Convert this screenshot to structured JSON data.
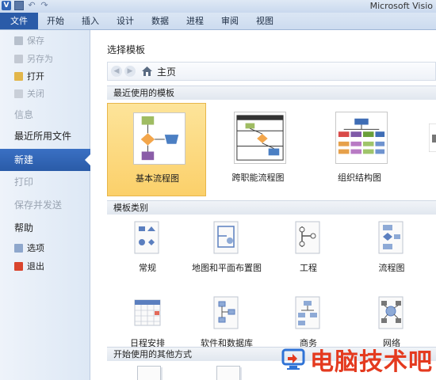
{
  "window": {
    "title": "Microsoft Visio"
  },
  "quick_access": {
    "logo_letter": "V"
  },
  "ribbon": {
    "tabs": [
      "文件",
      "开始",
      "插入",
      "设计",
      "数据",
      "进程",
      "审阅",
      "视图"
    ]
  },
  "backstage_nav": {
    "save": "保存",
    "save_as": "另存为",
    "open": "打开",
    "close": "关闭",
    "info": "信息",
    "recent": "最近所用文件",
    "new": "新建",
    "print": "打印",
    "save_send": "保存并发送",
    "help": "帮助",
    "options": "选项",
    "exit": "退出"
  },
  "main": {
    "heading": "选择模板",
    "breadcrumb": "主页",
    "section_recent": "最近使用的模板",
    "recent_templates": [
      "基本流程图",
      "跨职能流程图",
      "组织结构图"
    ],
    "section_categories": "模板类别",
    "categories": [
      "常规",
      "地图和平面布置图",
      "工程",
      "流程图",
      "日程安排",
      "软件和数据库",
      "商务",
      "网络"
    ],
    "section_other": "开始使用的其他方式"
  },
  "watermark": {
    "text": "电脑技术吧"
  },
  "colors": {
    "ribbon_accent": "#2a5ba8",
    "selected_template": "#fbd06a",
    "watermark": "#e43a1f"
  }
}
